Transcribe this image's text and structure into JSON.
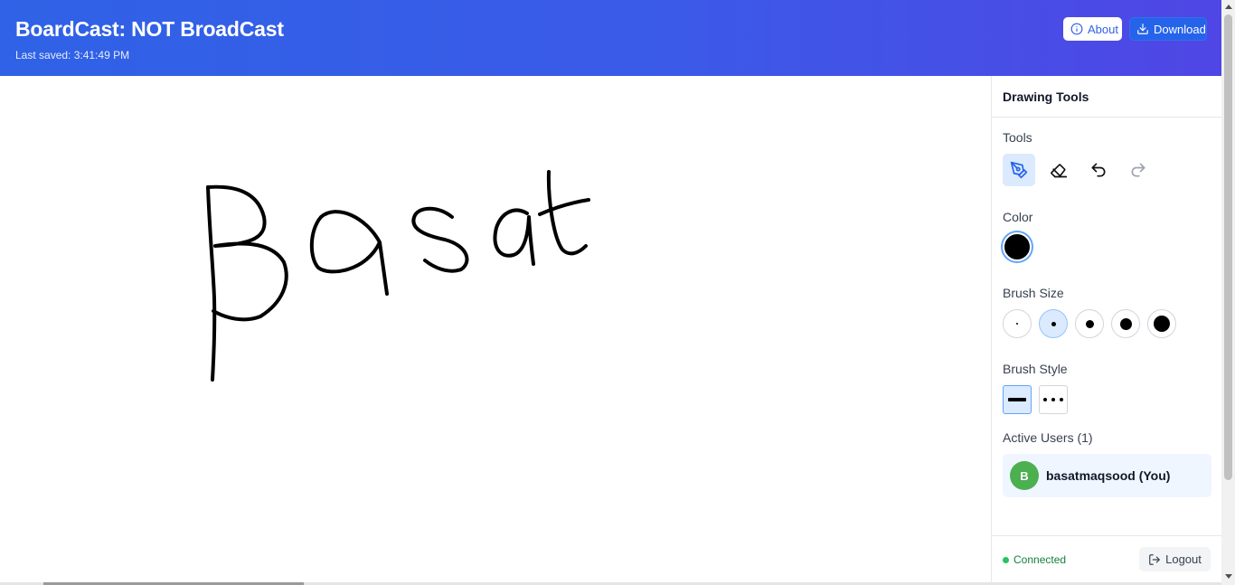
{
  "header": {
    "title": "BoardCast: NOT BroadCast",
    "last_saved": "Last saved: 3:41:49 PM",
    "about_label": "About",
    "download_label": "Download"
  },
  "panel": {
    "title": "Drawing Tools",
    "tools_label": "Tools",
    "tools": [
      "pen-icon",
      "eraser-icon",
      "undo-icon",
      "redo-icon"
    ],
    "active_tool": "pen",
    "color_label": "Color",
    "selected_color": "#000000",
    "brush_size_label": "Brush Size",
    "brush_sizes_count": 5,
    "selected_brush_size_index": 1,
    "brush_style_label": "Brush Style",
    "brush_styles": [
      "solid",
      "dotted"
    ],
    "selected_brush_style": "solid",
    "active_users_label": "Active Users (1)",
    "users": [
      {
        "initial": "B",
        "name": "basatmaqsood (You)",
        "avatar_color": "#4caf50"
      }
    ],
    "status": "Connected",
    "logout_label": "Logout"
  },
  "colors": {
    "header_gradient_start": "#2f62e6",
    "header_gradient_end": "#4f46e5",
    "accent": "#2563eb",
    "status_green": "#22c55e"
  }
}
